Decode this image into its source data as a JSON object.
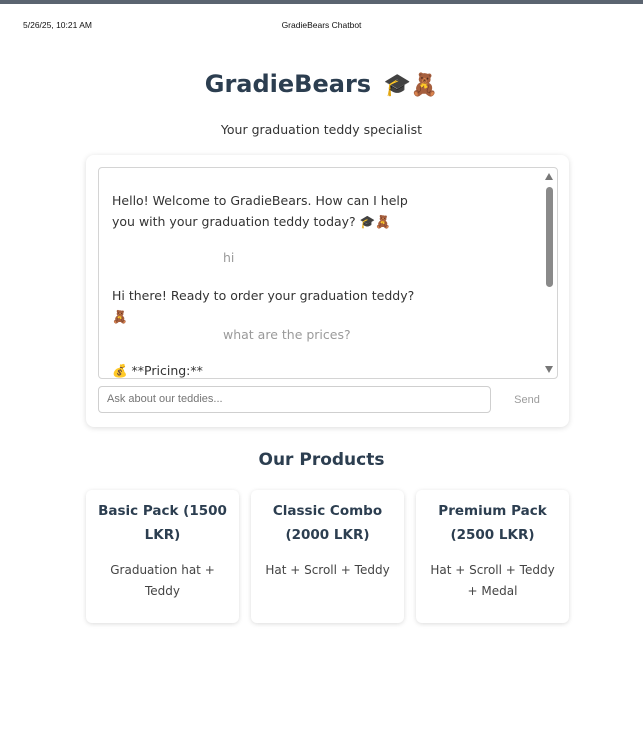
{
  "print_header": {
    "date": "5/26/25, 10:21 AM",
    "title": "GradieBears Chatbot"
  },
  "header": {
    "brand": "GradieBears",
    "brand_emoji": "🎓🧸",
    "tagline": "Your graduation teddy specialist"
  },
  "chat": {
    "messages": [
      {
        "role": "bot",
        "text": "Hello! Welcome to GradieBears. How can I help you with your graduation teddy today? 🎓🧸"
      },
      {
        "role": "user",
        "text": "hi"
      },
      {
        "role": "bot",
        "text": "Hi there! Ready to order your graduation teddy? 🧸"
      },
      {
        "role": "user",
        "text": "what are the prices?"
      },
      {
        "role": "bot",
        "text": "💰 **Pricing:**"
      }
    ],
    "input_placeholder": "Ask about our teddies...",
    "input_value": "",
    "send_label": "Send"
  },
  "products": {
    "heading": "Our Products",
    "items": [
      {
        "name": "Basic Pack (1500 LKR)",
        "description": "Graduation hat + Teddy"
      },
      {
        "name": "Classic Combo (2000 LKR)",
        "description": "Hat + Scroll + Teddy"
      },
      {
        "name": "Premium Pack (2500 LKR)",
        "description": "Hat + Scroll + Teddy + Medal"
      }
    ]
  }
}
